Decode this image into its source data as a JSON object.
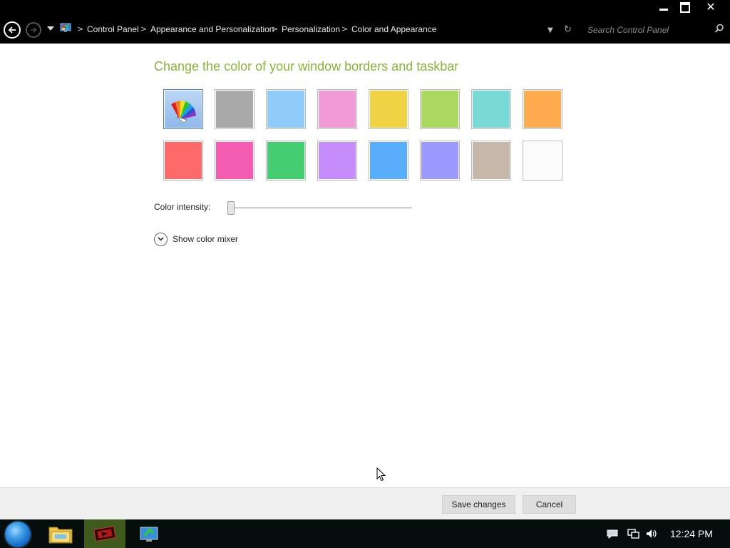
{
  "window": {
    "minimize": "minimize",
    "maximize": "restore",
    "close": "close"
  },
  "breadcrumb": {
    "items": [
      {
        "label": "Control Panel"
      },
      {
        "label": "Appearance and Personalization"
      },
      {
        "label": "Personalization"
      },
      {
        "label": "Color and Appearance"
      }
    ]
  },
  "search": {
    "placeholder": "Search Control Panel"
  },
  "main": {
    "heading": "Change the color of your window borders and taskbar",
    "swatches": [
      {
        "name": "automatic",
        "color": "#8fb8ec"
      },
      {
        "name": "gray",
        "color": "#a9a9a9"
      },
      {
        "name": "sky",
        "color": "#8fcbfb"
      },
      {
        "name": "pink",
        "color": "#f19ad6"
      },
      {
        "name": "yellow",
        "color": "#f0d245"
      },
      {
        "name": "lime",
        "color": "#abd960"
      },
      {
        "name": "teal",
        "color": "#79dad5"
      },
      {
        "name": "orange",
        "color": "#fdab4e"
      },
      {
        "name": "red",
        "color": "#fd6a6a"
      },
      {
        "name": "magenta",
        "color": "#f35cb1"
      },
      {
        "name": "green",
        "color": "#45cd71"
      },
      {
        "name": "violet",
        "color": "#c68dfa"
      },
      {
        "name": "blue",
        "color": "#59adfb"
      },
      {
        "name": "periwinkle",
        "color": "#9b99fb"
      },
      {
        "name": "taupe",
        "color": "#c5b8ab"
      },
      {
        "name": "white",
        "color": "#fbfbfb"
      }
    ],
    "intensity_label": "Color intensity:",
    "intensity_value": 0,
    "mixer_label": "Show color mixer"
  },
  "footer": {
    "save_label": "Save changes",
    "cancel_label": "Cancel"
  },
  "taskbar": {
    "clock": "12:24 PM"
  }
}
